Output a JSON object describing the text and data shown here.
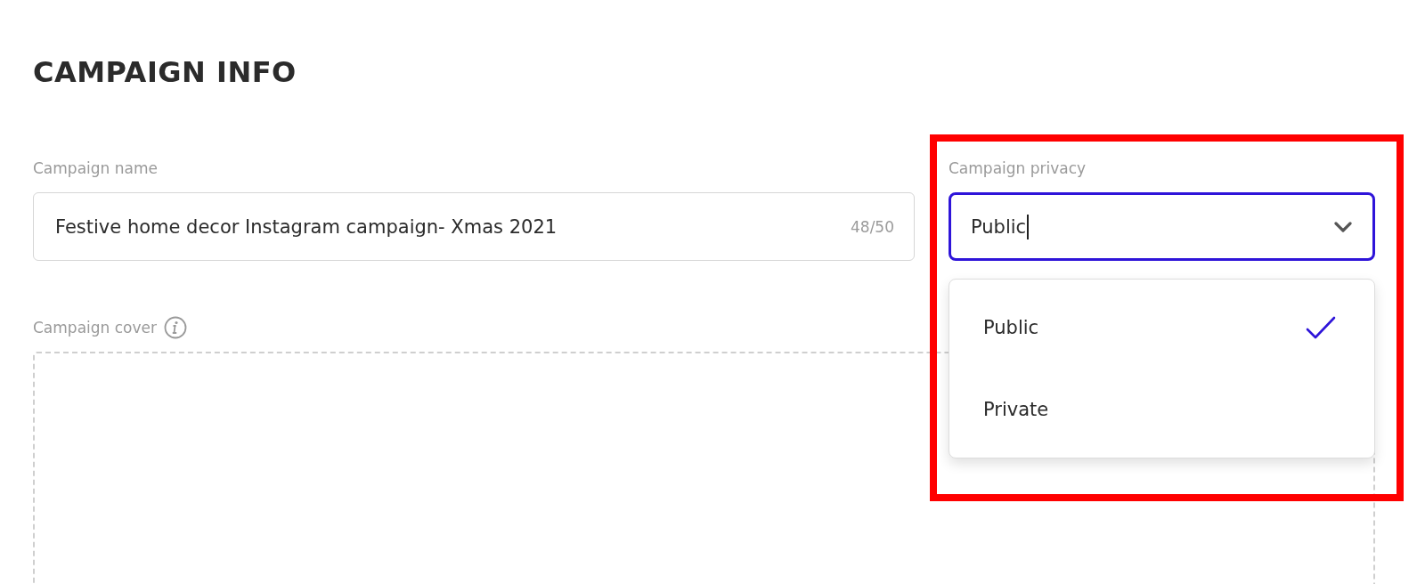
{
  "heading": "CAMPAIGN INFO",
  "name_field": {
    "label": "Campaign name",
    "value": "Festive home decor Instagram campaign- Xmas 2021",
    "counter": "48/50"
  },
  "privacy_field": {
    "label": "Campaign privacy",
    "value": "Public",
    "expanded": true,
    "options": [
      {
        "label": "Public",
        "selected": true
      },
      {
        "label": "Private",
        "selected": false
      }
    ]
  },
  "cover": {
    "label": "Campaign cover"
  }
}
